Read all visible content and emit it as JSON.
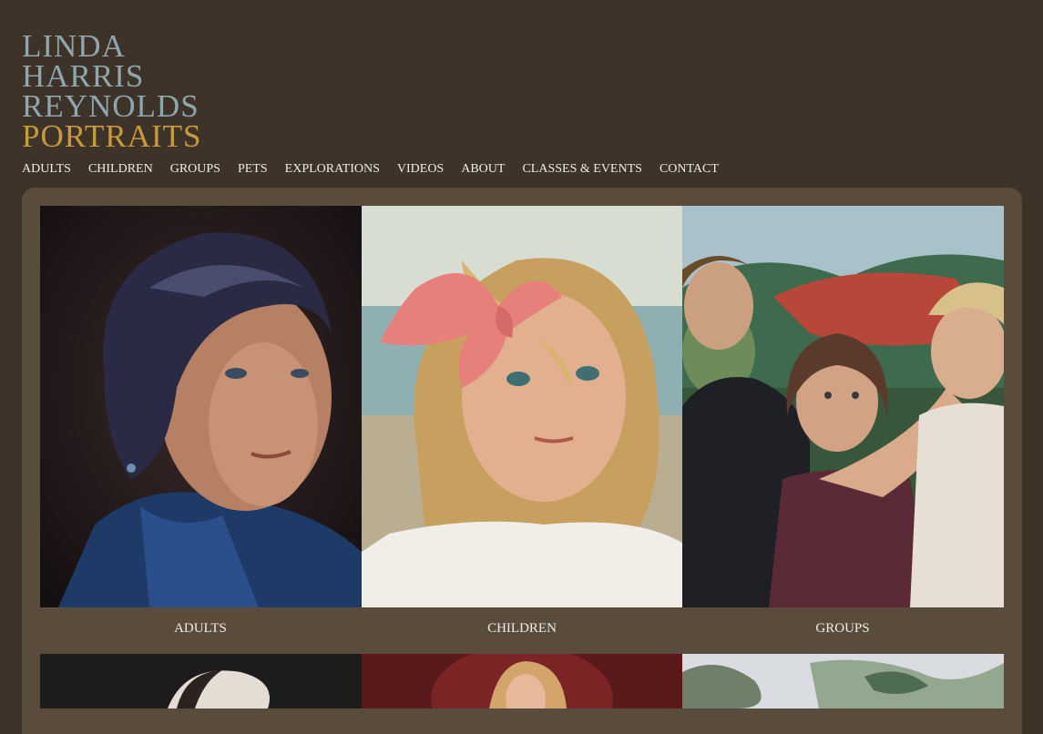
{
  "logo": {
    "line1": "LINDA",
    "line2": "HARRIS",
    "line3": "REYNOLDS",
    "line4": "PORTRAITS",
    "colors": {
      "name": "#8fa6ad",
      "portraits": "#c89a3c"
    }
  },
  "nav": [
    "ADULTS",
    "CHILDREN",
    "GROUPS",
    "PETS",
    "EXPLORATIONS",
    "VIDEOS",
    "ABOUT",
    "CLASSES & EVENTS",
    "CONTACT"
  ],
  "gallery": {
    "captions": [
      "ADULTS",
      "CHILDREN",
      "GROUPS"
    ]
  },
  "colors": {
    "background": "#3d3329",
    "panel": "#5a4c3d",
    "text": "#f1ece2"
  }
}
